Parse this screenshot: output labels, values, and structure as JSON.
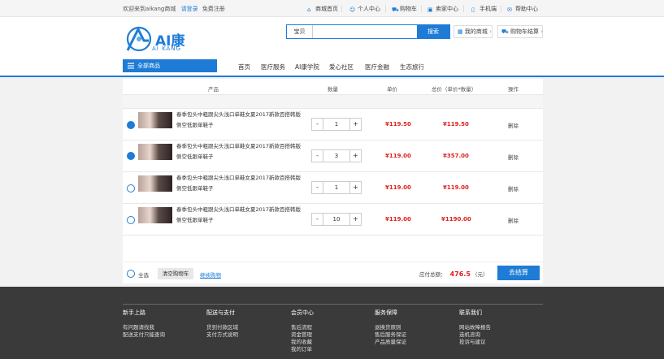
{
  "topbar": {
    "welcome": "欢迎来到aikang商城",
    "login": "请登录",
    "register": "免费注册",
    "nav": [
      {
        "label": "商城首页",
        "icon": "home-icon"
      },
      {
        "label": "个人中心",
        "icon": "user-icon"
      },
      {
        "label": "购物车",
        "icon": "cart-icon"
      },
      {
        "label": "卖家中心",
        "icon": "seller-icon"
      },
      {
        "label": "手机端",
        "icon": "phone-icon"
      },
      {
        "label": "帮助中心",
        "icon": "help-icon"
      }
    ]
  },
  "brand": {
    "name": "AI康",
    "sub": "AI KANG"
  },
  "search": {
    "category": "宝贝",
    "placeholder": "",
    "button": "搜索"
  },
  "header_buttons": {
    "my_store": "我的商城",
    "cart_checkout": "购物车结算"
  },
  "all_categories": "全部商品",
  "main_nav": [
    "首页",
    "医疗服务",
    "AI康学院",
    "爱心社区",
    "医疗金融",
    "生态旅行"
  ],
  "table_headers": {
    "product": "产品",
    "qty": "数量",
    "unit_price": "单价",
    "total": "总价（单价*数量）",
    "action": "操作"
  },
  "cart": {
    "items": [
      {
        "checked": true,
        "name_line1": "春季包头中粗跟尖头浅口单鞋女夏2017新款百搭韩版",
        "name_line2": "侧空低跟单鞋子",
        "qty": "1",
        "unit_price": "¥119.50",
        "total": "¥119.50",
        "action": "删除"
      },
      {
        "checked": true,
        "name_line1": "春季包头中粗跟尖头浅口单鞋女夏2017新款百搭韩版",
        "name_line2": "侧空低跟单鞋子",
        "qty": "3",
        "unit_price": "¥119.00",
        "total": "¥357.00",
        "action": "删除"
      },
      {
        "checked": false,
        "name_line1": "春季包头中粗跟尖头浅口单鞋女夏2017新款百搭韩版",
        "name_line2": "侧空低跟单鞋子",
        "qty": "1",
        "unit_price": "¥119.00",
        "total": "¥119.00",
        "action": "删除"
      },
      {
        "checked": false,
        "name_line1": "春季包头中粗跟尖头浅口单鞋女夏2017新款百搭韩版",
        "name_line2": "侧空低跟单鞋子",
        "qty": "10",
        "unit_price": "¥119.00",
        "total": "¥1190.00",
        "action": "删除"
      }
    ],
    "minus": "-",
    "plus": "+"
  },
  "summary": {
    "select_all": "全选",
    "clear_cart": "清空购物车",
    "continue": "继续购物",
    "total_label": "应付总额：",
    "total_value": "476.5",
    "total_unit": "（元）",
    "checkout": "去结算"
  },
  "footer": {
    "columns": [
      {
        "title": "新手上路",
        "items": [
          "有问题请找我",
          "配送支付只能查询"
        ]
      },
      {
        "title": "配送与支付",
        "items": [
          "货到付款区域",
          "支付方式说明"
        ]
      },
      {
        "title": "会员中心",
        "items": [
          "售后流程",
          "资金管理",
          "我的收藏",
          "我的订单"
        ]
      },
      {
        "title": "服务保障",
        "items": [
          "退换货原则",
          "售后服务保证",
          "产品质量保证"
        ]
      },
      {
        "title": "联系我们",
        "items": [
          "网站故障报告",
          "选机咨询",
          "投诉与建议"
        ]
      }
    ]
  },
  "colors": {
    "accent": "#1e7bd6",
    "price": "#e02020",
    "footer": "#3a3a3a"
  }
}
